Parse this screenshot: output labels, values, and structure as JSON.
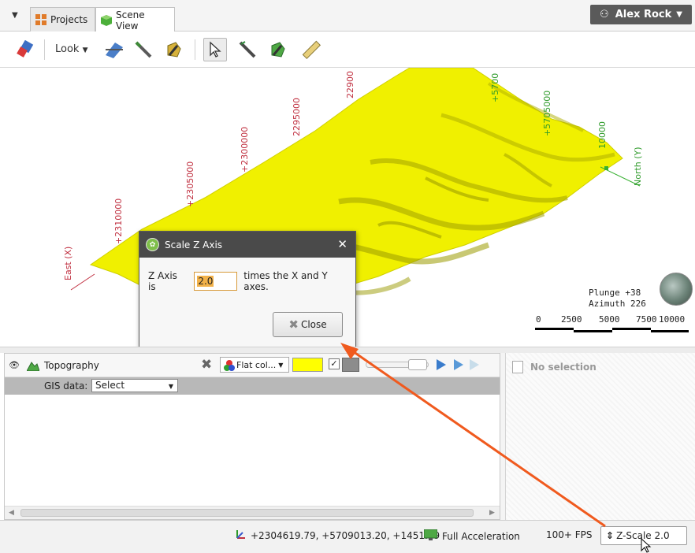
{
  "tabs": [
    {
      "label": "Projects",
      "icon": "projects-grid-icon"
    },
    {
      "label": "Scene View",
      "icon": "scene-cube-icon"
    }
  ],
  "user": {
    "name": "Alex Rock"
  },
  "toolbar": {
    "look_label": "Look"
  },
  "scene": {
    "east_ticks": [
      "+2310000",
      "+2305000",
      "+2300000",
      "2295000",
      "22900"
    ],
    "north_ticks": [
      "+5700",
      "+5705000",
      "10000"
    ],
    "east_axis_label": "East (X)",
    "north_axis_label": "North (Y)",
    "plunge": "Plunge +38",
    "azimuth": "Azimuth 226",
    "scale_labels": [
      "0",
      "2500",
      "5000",
      "7500",
      "10000"
    ],
    "surface_color": "#f2f200"
  },
  "dialog": {
    "title": "Scale Z Axis",
    "prefix": "Z Axis is",
    "value": "2.0",
    "suffix": "times the X and Y axes.",
    "close_label": "Close"
  },
  "properties": {
    "object_name": "Topography",
    "color_mode": "Flat col...",
    "color": "#ffff00",
    "gis_label": "GIS data:",
    "gis_value": "Select"
  },
  "selection": {
    "text": "No selection"
  },
  "status": {
    "coordinates": "+2304619.79, +5709013.20, +1451.49",
    "acceleration": "Full Acceleration",
    "fps": "100+ FPS",
    "zscale": "Z-Scale 2.0"
  },
  "colors": {
    "arrow": "#f05a1e",
    "dialog_title_bg": "#4a4a4a",
    "user_btn_bg": "#5a5a5a"
  }
}
